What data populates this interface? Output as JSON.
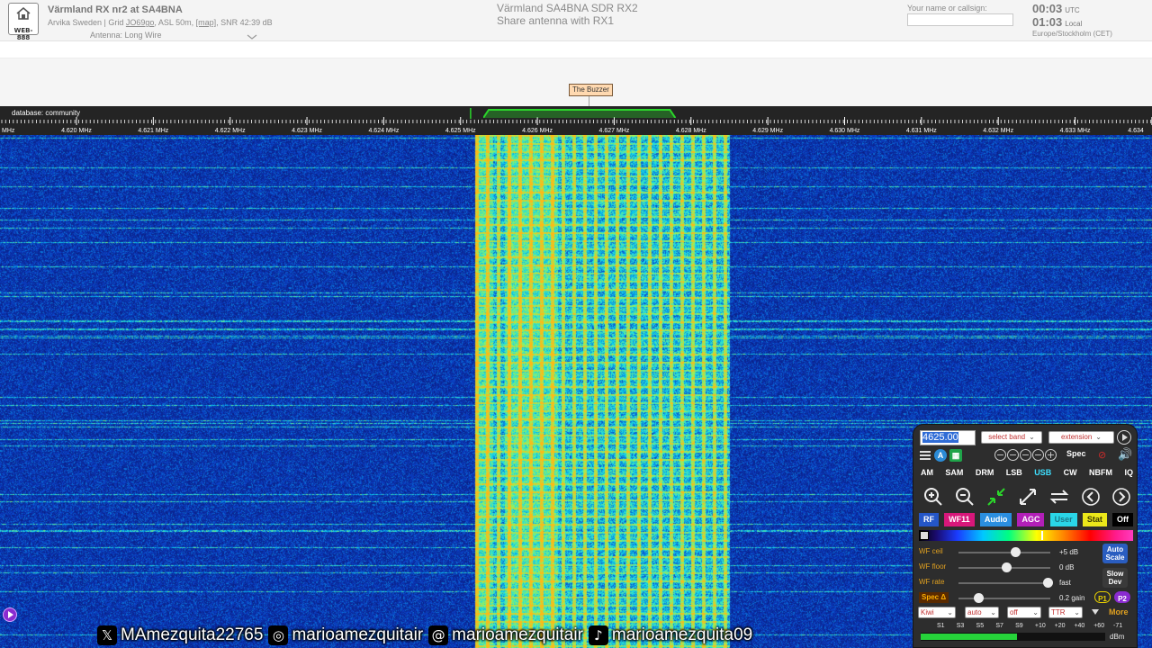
{
  "header": {
    "logo_text": "WEB-888",
    "title": "Värmland RX nr2 at SA4BNA",
    "location_parts": [
      "Arvika Sweden | Grid ",
      "JO69go",
      ", ASL 50m, ",
      "[map]",
      ", SNR 42:39 dB"
    ],
    "antenna": "Antenna: Long Wire",
    "center_title_1": "Värmland SA4BNA SDR RX2",
    "center_title_2": "Share antenna with RX1",
    "callsign_label": "Your name or callsign:",
    "utc_time": "00:03",
    "utc_suffix": "UTC",
    "local_time": "01:03",
    "local_suffix": "Local",
    "timezone": "Europe/Stockholm (CET)"
  },
  "labels": {
    "dx_label": "The Buzzer"
  },
  "scale": {
    "database": "database: community",
    "left_unit": "MHz",
    "ticks": [
      {
        "text": "4.620 MHz",
        "mhz": 4.62
      },
      {
        "text": "4.621 MHz",
        "mhz": 4.621
      },
      {
        "text": "4.622 MHz",
        "mhz": 4.622
      },
      {
        "text": "4.623 MHz",
        "mhz": 4.623
      },
      {
        "text": "4.624 MHz",
        "mhz": 4.624
      },
      {
        "text": "4.625 MHz",
        "mhz": 4.625
      },
      {
        "text": "4.626 MHz",
        "mhz": 4.626
      },
      {
        "text": "4.627 MHz",
        "mhz": 4.627
      },
      {
        "text": "4.628 MHz",
        "mhz": 4.628
      },
      {
        "text": "4.629 MHz",
        "mhz": 4.629
      },
      {
        "text": "4.630 MHz",
        "mhz": 4.63
      },
      {
        "text": "4.631 MHz",
        "mhz": 4.631
      },
      {
        "text": "4.632 MHz",
        "mhz": 4.632
      },
      {
        "text": "4.633 MHz",
        "mhz": 4.633
      },
      {
        "text": "4.634",
        "mhz": 4.634
      }
    ],
    "passband_mhz": [
      4.6253,
      4.6278
    ]
  },
  "social": [
    {
      "icon": "x-icon",
      "glyph": "𝕏",
      "handle": "MAmezquita22765"
    },
    {
      "icon": "instagram-icon",
      "glyph": "◎",
      "handle": "marioamezquitair"
    },
    {
      "icon": "threads-icon",
      "glyph": "@",
      "handle": "marioamezquitair"
    },
    {
      "icon": "tiktok-icon",
      "glyph": "♪",
      "handle": "marioamezquita09"
    }
  ],
  "panel": {
    "frequency": "4625.00",
    "band_select": "select band",
    "extension_select": "extension",
    "spec_label": "Spec",
    "modes": [
      {
        "label": "AM",
        "active": false
      },
      {
        "label": "SAM",
        "active": false
      },
      {
        "label": "DRM",
        "active": false
      },
      {
        "label": "LSB",
        "active": false
      },
      {
        "label": "USB",
        "active": true
      },
      {
        "label": "CW",
        "active": false
      },
      {
        "label": "NBFM",
        "active": false
      },
      {
        "label": "IQ",
        "active": false
      }
    ],
    "tabs": [
      {
        "label": "RF",
        "bg": "#2456c8",
        "fg": "#ffffff"
      },
      {
        "label": "WF11",
        "bg": "#d8177a",
        "fg": "#ffffff"
      },
      {
        "label": "Audio",
        "bg": "#2a8ee0",
        "fg": "#ffffff"
      },
      {
        "label": "AGC",
        "bg": "#b21fb8",
        "fg": "#ffffff"
      },
      {
        "label": "User",
        "bg": "#2ad6e8",
        "fg": "#1a7a8a"
      },
      {
        "label": "Stat",
        "bg": "#ece81a",
        "fg": "#3a3a00"
      },
      {
        "label": "Off",
        "bg": "#000000",
        "fg": "#ffffff"
      }
    ],
    "sliders": [
      {
        "label": "WF ceil",
        "value": "+5 dB",
        "level": 0.6
      },
      {
        "label": "WF floor",
        "value": "0 dB",
        "level": 0.5
      },
      {
        "label": "WF rate",
        "value": "fast",
        "level": 0.98
      },
      {
        "label": "Spec Δ",
        "value": "0.2 gain",
        "level": 0.18
      }
    ],
    "autoscale_1": "Auto",
    "autoscale_2": "Scale",
    "slow_1": "Slow",
    "slow_2": "Dev",
    "p1": "P1",
    "p2": "P2",
    "bottom_selects": [
      "Kiwi",
      "auto",
      "off",
      "TTR"
    ],
    "more": "More",
    "smeter_labels": [
      "S1",
      "S3",
      "S5",
      "S7",
      "S9",
      "+10",
      "+20",
      "+40",
      "+60",
      "-71"
    ],
    "smeter_unit": "dBm",
    "smeter_level": 0.52
  },
  "colors": {
    "passband": "#2bd62b",
    "active_mode": "#3fe0ff",
    "slider_label": "#e0a020"
  }
}
